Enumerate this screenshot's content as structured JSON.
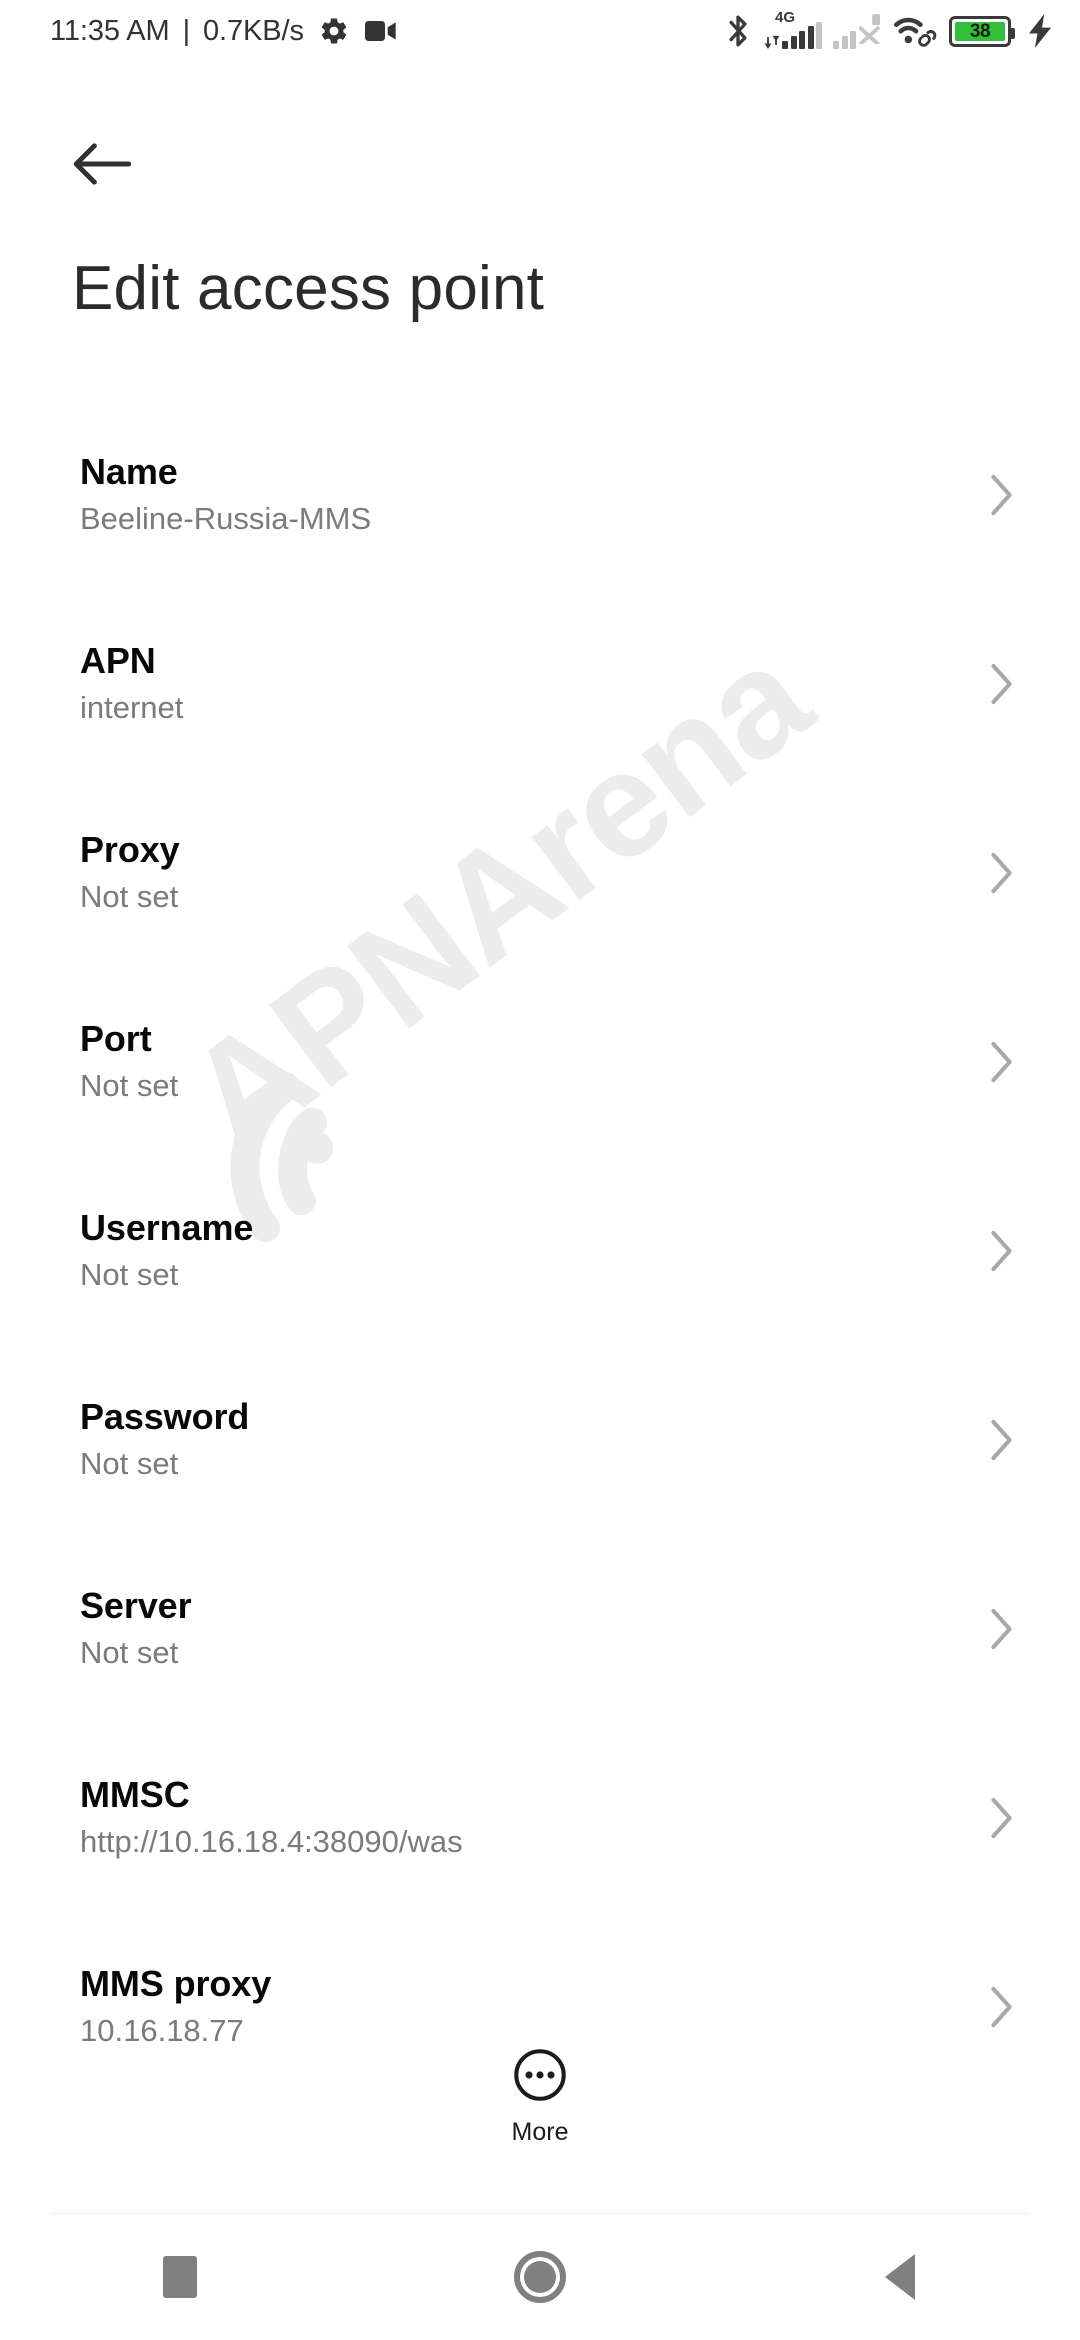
{
  "status_bar": {
    "time": "11:35 AM",
    "separator": "|",
    "network_speed": "0.7KB/s",
    "icons_left": [
      "gear-icon",
      "camcorder-icon"
    ],
    "bluetooth_icon": "bluetooth-icon",
    "network_type": "4G",
    "sim1_signal_bars": 4,
    "sim1_total_bars": 5,
    "sim2_signal_bars": 2,
    "sim2_total_bars": 4,
    "sim2_state": "no-service",
    "wifi_icon": "wifi-icon",
    "wifi_link_icon": "link-icon",
    "battery_level": "38",
    "battery_color": "#31c03a",
    "charging": true,
    "icon_color": "#3a3a3a"
  },
  "header": {
    "back_icon": "arrow-left-icon",
    "title": "Edit access point"
  },
  "watermark": {
    "text": "APNArena",
    "color": "#ececec"
  },
  "settings": {
    "chevron_icon": "chevron-right-icon",
    "rows": [
      {
        "title": "Name",
        "value": "Beeline-Russia-MMS"
      },
      {
        "title": "APN",
        "value": "internet"
      },
      {
        "title": "Proxy",
        "value": "Not set"
      },
      {
        "title": "Port",
        "value": "Not set"
      },
      {
        "title": "Username",
        "value": "Not set"
      },
      {
        "title": "Password",
        "value": "Not set"
      },
      {
        "title": "Server",
        "value": "Not set"
      },
      {
        "title": "MMSC",
        "value": "http://10.16.18.4:38090/was"
      },
      {
        "title": "MMS proxy",
        "value": "10.16.18.77"
      }
    ]
  },
  "more_button": {
    "icon": "more-horizontal-circle-icon",
    "label": "More"
  },
  "nav_bar": {
    "recents_icon": "square-icon",
    "home_icon": "circle-icon",
    "back_icon": "triangle-left-icon",
    "color": "#808080"
  }
}
